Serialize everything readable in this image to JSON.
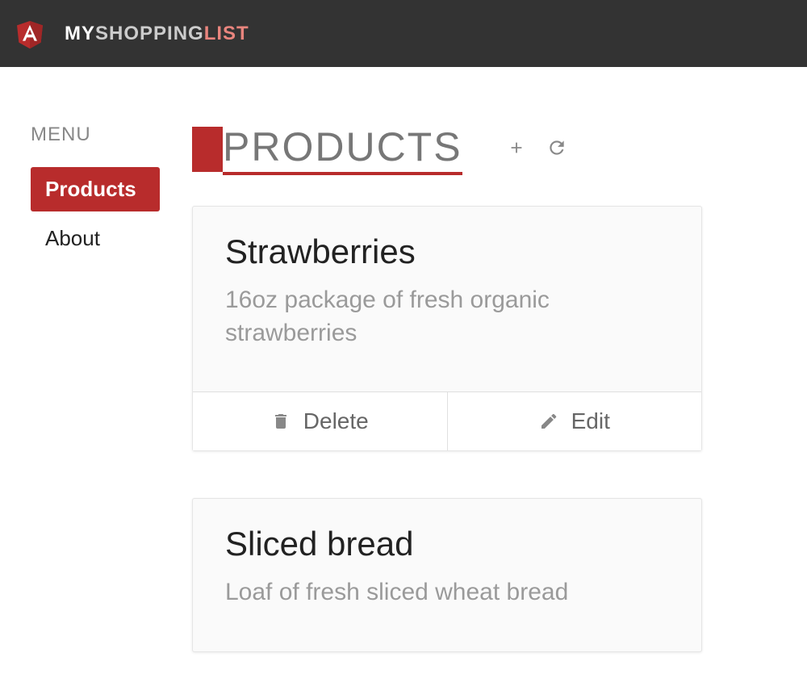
{
  "header": {
    "title_my": "MY",
    "title_shopping": "SHOPPING",
    "title_list": "LIST"
  },
  "sidebar": {
    "menu_label": "MENU",
    "items": [
      {
        "label": "Products",
        "active": true
      },
      {
        "label": "About",
        "active": false
      }
    ]
  },
  "main": {
    "page_title": "PRODUCTS",
    "actions": {
      "delete_label": "Delete",
      "edit_label": "Edit"
    },
    "products": [
      {
        "name": "Strawberries",
        "description": "16oz package of fresh organic strawberries"
      },
      {
        "name": "Sliced bread",
        "description": "Loaf of fresh sliced wheat bread"
      }
    ]
  }
}
